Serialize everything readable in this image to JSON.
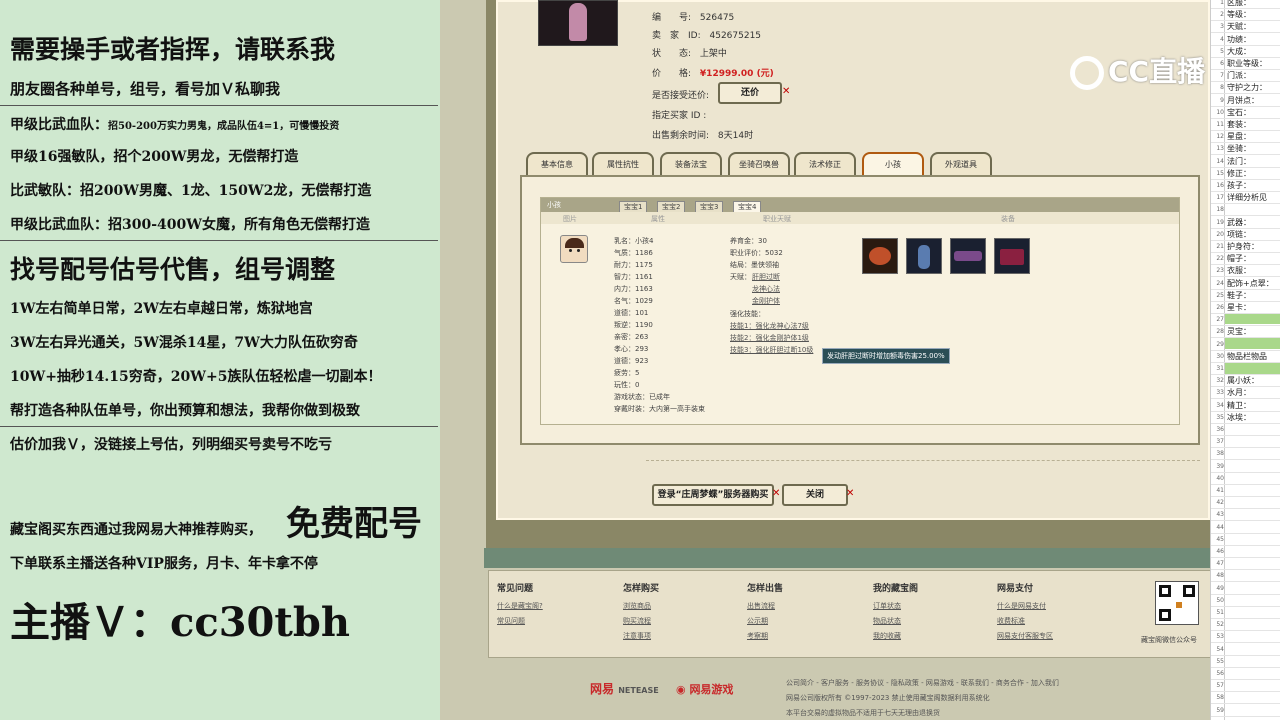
{
  "left_overlay": {
    "lines": [
      "需要操手或者指挥，请联系我",
      "朋友圈各种单号，组号，看号加Ｖ私聊我",
      "甲级比武血队：",
      "招50-200万实力男鬼，成品队伍4=1，可慢慢投资",
      "甲级16强敏队，招个200W男龙，无偿帮打造",
      "比武敏队：招200W男魔、1龙、150W2龙，无偿帮打造",
      "甲级比武血队：招300-400W女魔，所有角色无偿帮打造",
      "找号配号估号代售，组号调整",
      "1W左右简单日常，2W左右卓越日常，炼狱地宫",
      "3W左右异光通关，5W混杀14星，7W大力队伍砍穷奇",
      "10W+抽秒14.15穷奇，20W+5族队伍轻松虐一切副本！",
      "帮打造各种队伍单号，你出预算和想法，我帮你做到极致",
      "估价加我Ｖ，没链接上号估，列明细买号卖号不吃亏",
      "藏宝阁买东西通过我网易大神推荐购买，",
      "免费配号",
      "下单联系主播送各种VIP服务，月卡、年卡拿不停",
      "主播Ｖ：cc30tbh"
    ]
  },
  "listing": {
    "number_label": "编　　号:",
    "number": "526475",
    "seller_label": "卖　家　ID:",
    "seller": "452675215",
    "status_label": "状　　态:",
    "status": "上架中",
    "price_label": "价　　格:",
    "price": "¥12999.00 (元)",
    "bargain_label": "是否接受还价:",
    "bargain_button": "还价",
    "buyer_label": "指定买家 ID :",
    "remaining_label": "出售剩余时间:",
    "remaining": "8天14时"
  },
  "tabs": [
    "基本信息",
    "属性抗性",
    "装备法宝",
    "坐骑召唤兽",
    "法术修正",
    "小孩",
    "外观道具"
  ],
  "child": {
    "title": "小孩",
    "subtabs": [
      "宝宝1",
      "宝宝2",
      "宝宝3",
      "宝宝4"
    ],
    "col_headers": [
      "图片",
      "属性",
      "职业天赋",
      "装备"
    ],
    "attrs": [
      "乳名：小孩4",
      "气质：1186",
      "耐力：1175",
      "智力：1161",
      "内力：1163",
      "名气：1029",
      "道德：101",
      "叛逆：1190",
      "亲密：263",
      "孝心：293",
      "道德：923",
      "疲劳：5",
      "玩性：0",
      "游戏状态：已成年",
      "穿戴时装：大内第一高手装束"
    ],
    "career": [
      "养育金：30",
      "职业评价：5032",
      "结局：墨侠领袖",
      "天赋：",
      "肝胆过断",
      "龙神心法",
      "金刚护体",
      "强化技能：",
      "技能1：强化龙神心法7级",
      "技能2：强化金刚护体1级",
      "技能3：强化肝胆过断10级"
    ],
    "tooltip": "发动肝胆过断时增加额毒伤害25.00%"
  },
  "buttons": {
    "login": "登录“庄周梦蝶”服务器购买",
    "close": "关闭"
  },
  "footer": {
    "cols": [
      {
        "title": "常见问题",
        "links": [
          "什么是藏宝阁?",
          "常见问题"
        ]
      },
      {
        "title": "怎样购买",
        "links": [
          "浏览商品",
          "购买流程",
          "注意事项"
        ]
      },
      {
        "title": "怎样出售",
        "links": [
          "出售流程",
          "公示期",
          "考察期"
        ]
      },
      {
        "title": "我的藏宝阁",
        "links": [
          "订单状态",
          "物品状态",
          "我的收藏"
        ]
      },
      {
        "title": "网易支付",
        "links": [
          "什么是网易支付",
          "收费标准",
          "网易支付客服专区"
        ]
      }
    ],
    "qr_caption": "藏宝阁微信公众号",
    "bottom_links": "公司简介 - 客户服务 - 服务协议 - 隐私政策 - 网易游戏 - 联系我们 - 商务合作 - 加入我们",
    "copyright": "网易公司版权所有 ©1997-2023 禁止使用藏宝阁数据利用系统化",
    "notice": "本平台交易的虚拟物品不适用于七天无理由退换货",
    "logo1": "网易",
    "logo1b": "NETEASE",
    "logo2": "网易游戏"
  },
  "watermark": "CC直播",
  "sheet": {
    "rows": [
      {
        "n": "1",
        "t": "区服："
      },
      {
        "n": "2",
        "t": "等级："
      },
      {
        "n": "3",
        "t": "天赋："
      },
      {
        "n": "4",
        "t": "功绩："
      },
      {
        "n": "5",
        "t": "大成："
      },
      {
        "n": "6",
        "t": "职业等级："
      },
      {
        "n": "7",
        "t": "门派："
      },
      {
        "n": "8",
        "t": "守护之力："
      },
      {
        "n": "9",
        "t": "月饼点："
      },
      {
        "n": "10",
        "t": "宝石："
      },
      {
        "n": "11",
        "t": "套装："
      },
      {
        "n": "12",
        "t": "星盘："
      },
      {
        "n": "13",
        "t": "坐骑："
      },
      {
        "n": "14",
        "t": "法门："
      },
      {
        "n": "15",
        "t": "修正："
      },
      {
        "n": "16",
        "t": "孩子："
      },
      {
        "n": "17",
        "t": "详细分析见"
      },
      {
        "n": "18",
        "t": ""
      },
      {
        "n": "19",
        "t": "武器："
      },
      {
        "n": "20",
        "t": "项链："
      },
      {
        "n": "21",
        "t": "护身符："
      },
      {
        "n": "22",
        "t": "帽子："
      },
      {
        "n": "23",
        "t": "衣服："
      },
      {
        "n": "24",
        "t": "配饰+点翠："
      },
      {
        "n": "25",
        "t": "鞋子："
      },
      {
        "n": "26",
        "t": "星卡："
      },
      {
        "n": "27",
        "t": ""
      },
      {
        "n": "28",
        "t": "灵宝："
      },
      {
        "n": "29",
        "t": ""
      },
      {
        "n": "30",
        "t": "物品栏物品"
      },
      {
        "n": "31",
        "t": ""
      },
      {
        "n": "32",
        "t": "属小妖："
      },
      {
        "n": "33",
        "t": "水月："
      },
      {
        "n": "34",
        "t": "精卫："
      },
      {
        "n": "35",
        "t": "冰埃："
      },
      {
        "n": "36",
        "t": ""
      },
      {
        "n": "37",
        "t": ""
      },
      {
        "n": "38",
        "t": ""
      },
      {
        "n": "39",
        "t": ""
      },
      {
        "n": "40",
        "t": ""
      },
      {
        "n": "41",
        "t": ""
      },
      {
        "n": "42",
        "t": ""
      },
      {
        "n": "43",
        "t": ""
      },
      {
        "n": "44",
        "t": ""
      },
      {
        "n": "45",
        "t": ""
      },
      {
        "n": "46",
        "t": ""
      },
      {
        "n": "47",
        "t": ""
      },
      {
        "n": "48",
        "t": ""
      },
      {
        "n": "49",
        "t": ""
      },
      {
        "n": "50",
        "t": ""
      },
      {
        "n": "51",
        "t": ""
      },
      {
        "n": "52",
        "t": ""
      },
      {
        "n": "53",
        "t": ""
      },
      {
        "n": "54",
        "t": ""
      },
      {
        "n": "55",
        "t": ""
      },
      {
        "n": "56",
        "t": ""
      },
      {
        "n": "57",
        "t": ""
      },
      {
        "n": "58",
        "t": ""
      },
      {
        "n": "59",
        "t": ""
      }
    ]
  }
}
